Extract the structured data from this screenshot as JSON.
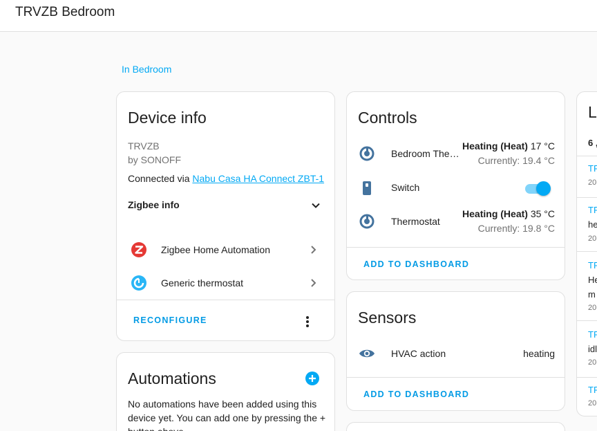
{
  "header": {
    "title": "TRVZB Bedroom"
  },
  "area_link": "In Bedroom",
  "device_info": {
    "title": "Device info",
    "model": "TRVZB",
    "manufacturer": "by SONOFF",
    "connected_prefix": "Connected via ",
    "connected_link": "Nabu Casa HA Connect ZBT-1",
    "zigbee_info_label": "Zigbee info",
    "integrations": [
      {
        "label": "Zigbee Home Automation",
        "icon": "zigbee-icon"
      },
      {
        "label": "Generic thermostat",
        "icon": "thermostat-icon"
      }
    ],
    "reconfigure_label": "RECONFIGURE"
  },
  "automations": {
    "title": "Automations",
    "empty_text": "No automations have been added using this device yet. You can add one by pressing the + button above."
  },
  "controls": {
    "title": "Controls",
    "rows": [
      {
        "name": "Bedroom The…",
        "mode": "Heating (Heat)",
        "target": " 17 °C",
        "current": "Currently: 19.4 °C",
        "icon": "thermostat-icon"
      },
      {
        "name": "Switch",
        "icon": "switch-icon",
        "toggle_on": true
      },
      {
        "name": "Thermostat",
        "mode": "Heating (Heat)",
        "target": " 35 °C",
        "current": "Currently: 19.8 °C",
        "icon": "thermostat-icon"
      }
    ],
    "add_label": "ADD TO DASHBOARD"
  },
  "sensors": {
    "title": "Sensors",
    "rows": [
      {
        "name": "HVAC action",
        "state": "heating",
        "icon": "eye-icon"
      }
    ],
    "add_label": "ADD TO DASHBOARD"
  },
  "logbook": {
    "title_partial": "L",
    "date_partial": "6 ,",
    "entries": [
      {
        "name": "TF",
        "detail": "",
        "time": "20"
      },
      {
        "name": "TF",
        "detail": "he",
        "time": "20"
      },
      {
        "name": "TF",
        "detail": "He",
        "detail2": "m",
        "time": "20"
      },
      {
        "name": "TF",
        "detail": "idl",
        "time": "20"
      },
      {
        "name": "TF",
        "detail": "",
        "time": "20"
      }
    ]
  },
  "colors": {
    "accent": "#03a9f4",
    "icon": "#44739e",
    "zigbee_red": "#e53935"
  }
}
